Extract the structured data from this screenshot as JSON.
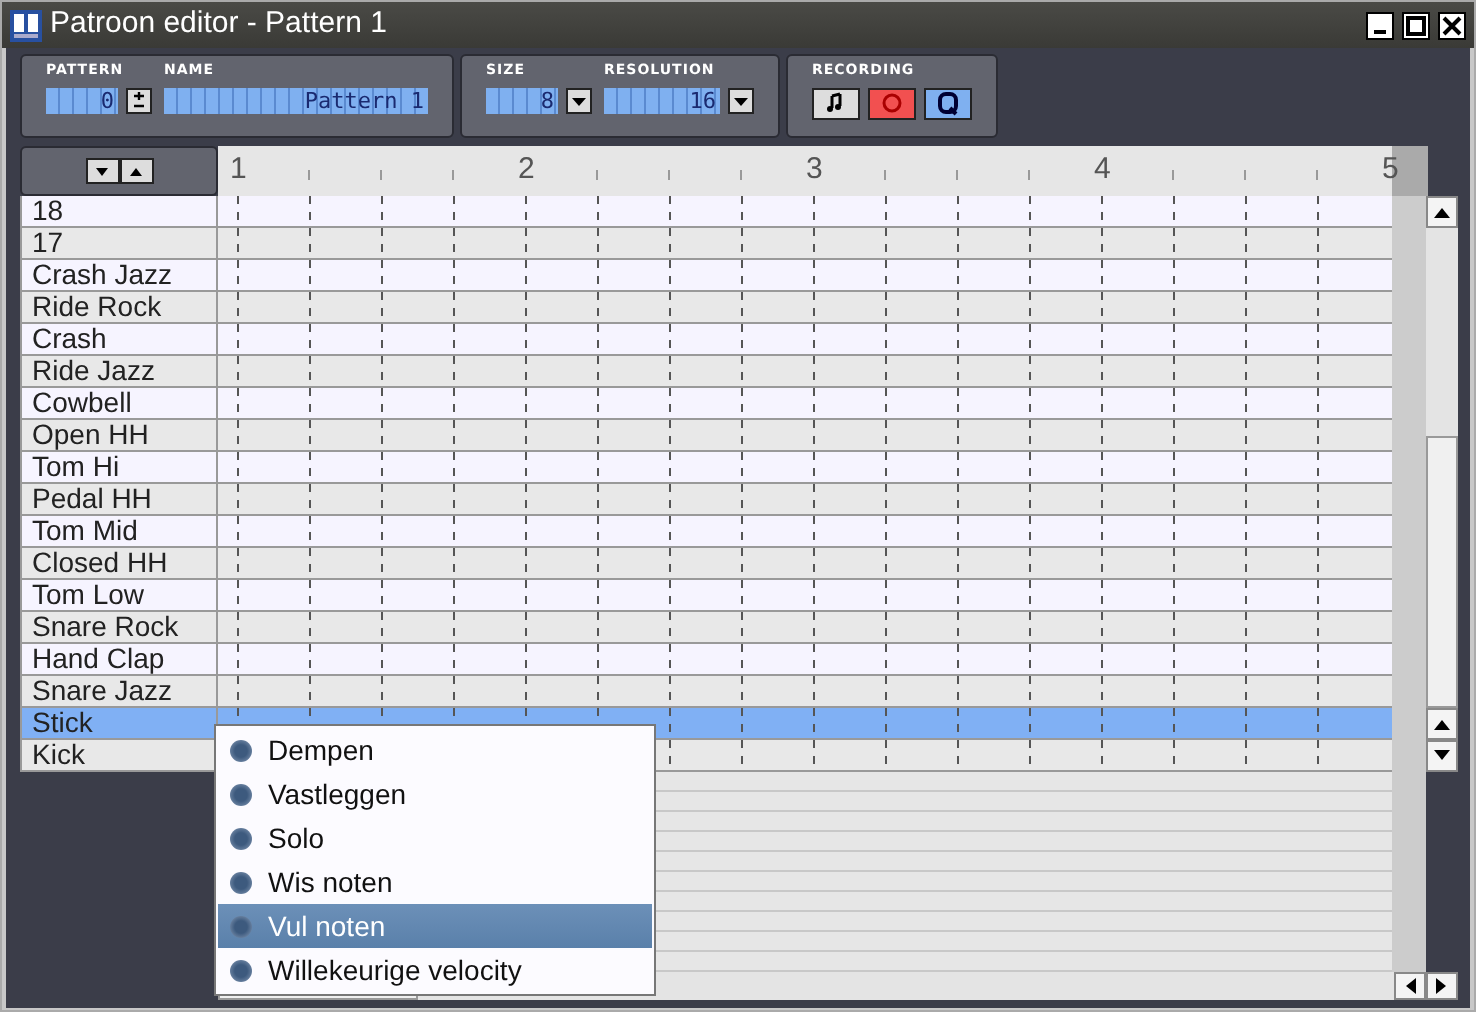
{
  "window": {
    "title": "Patroon editor - Pattern 1"
  },
  "toolbar": {
    "pattern_label": "PATTERN",
    "pattern_number": "0",
    "name_label": "NAME",
    "name": "Pattern 1",
    "size_label": "SIZE",
    "size": "8",
    "resolution_label": "RESOLUTION",
    "resolution": "16",
    "recording_label": "RECORDING"
  },
  "ruler": [
    "1",
    "2",
    "3",
    "4",
    "5"
  ],
  "instruments": [
    {
      "name": "18",
      "selected": false
    },
    {
      "name": "17",
      "selected": false
    },
    {
      "name": "Crash Jazz",
      "selected": false
    },
    {
      "name": "Ride Rock",
      "selected": false
    },
    {
      "name": "Crash",
      "selected": false
    },
    {
      "name": "Ride Jazz",
      "selected": false
    },
    {
      "name": "Cowbell",
      "selected": false
    },
    {
      "name": "Open HH",
      "selected": false
    },
    {
      "name": "Tom Hi",
      "selected": false
    },
    {
      "name": "Pedal HH",
      "selected": false
    },
    {
      "name": "Tom Mid",
      "selected": false
    },
    {
      "name": "Closed HH",
      "selected": false
    },
    {
      "name": "Tom Low",
      "selected": false
    },
    {
      "name": "Snare Rock",
      "selected": false
    },
    {
      "name": "Hand Clap",
      "selected": false
    },
    {
      "name": "Snare Jazz",
      "selected": false
    },
    {
      "name": "Stick",
      "selected": true
    },
    {
      "name": "Kick",
      "selected": false
    }
  ],
  "context_menu": [
    {
      "label": "Dempen",
      "selected": false
    },
    {
      "label": "Vastleggen",
      "selected": false
    },
    {
      "label": "Solo",
      "selected": false
    },
    {
      "label": "Wis noten",
      "selected": false
    },
    {
      "label": "Vul noten",
      "selected": true
    },
    {
      "label": "Willekeurige velocity",
      "selected": false
    }
  ]
}
